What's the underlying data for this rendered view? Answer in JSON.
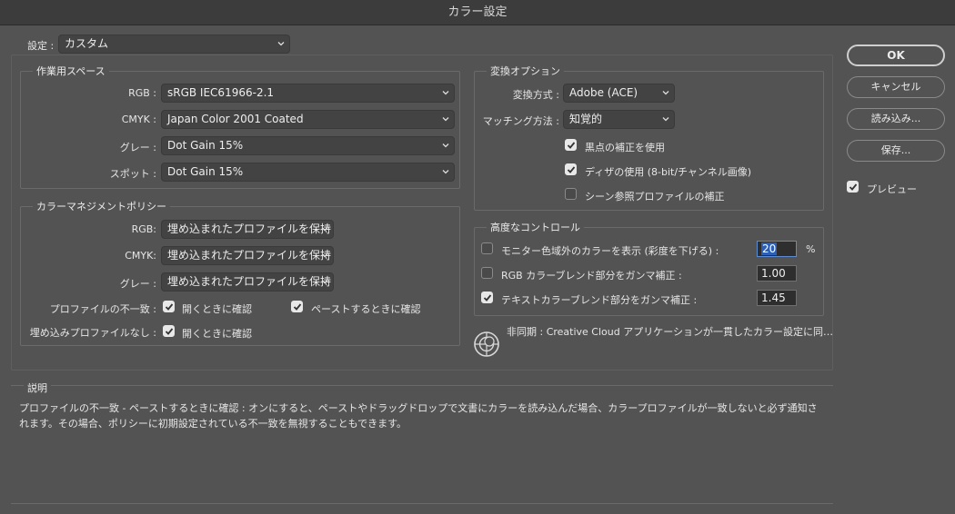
{
  "window": {
    "title": "カラー設定"
  },
  "settings": {
    "label": "設定 :",
    "value": "カスタム"
  },
  "working_spaces": {
    "title": "作業用スペース",
    "rgb": {
      "label": "RGB :",
      "value": "sRGB IEC61966-2.1"
    },
    "cmyk": {
      "label": "CMYK :",
      "value": "Japan Color 2001 Coated"
    },
    "gray": {
      "label": "グレー :",
      "value": "Dot Gain 15%"
    },
    "spot": {
      "label": "スポット :",
      "value": "Dot Gain 15%"
    }
  },
  "policies": {
    "title": "カラーマネジメントポリシー",
    "rgb": {
      "label": "RGB:",
      "value": "埋め込まれたプロファイルを保持"
    },
    "cmyk": {
      "label": "CMYK:",
      "value": "埋め込まれたプロファイルを保持"
    },
    "gray": {
      "label": "グレー :",
      "value": "埋め込まれたプロファイルを保持"
    },
    "mismatch": {
      "label": "プロファイルの不一致 :",
      "open_label": "開くときに確認",
      "open_checked": true,
      "paste_label": "ペーストするときに確認",
      "paste_checked": true
    },
    "missing": {
      "label": "埋め込みプロファイルなし :",
      "open_label": "開くときに確認",
      "open_checked": true
    }
  },
  "conversion": {
    "title": "変換オプション",
    "engine": {
      "label": "変換方式 :",
      "value": "Adobe (ACE)"
    },
    "intent": {
      "label": "マッチング方法 :",
      "value": "知覚的"
    },
    "bpc": {
      "label": "黒点の補正を使用",
      "checked": true
    },
    "dither": {
      "label": "ディザの使用 (8-bit/チャンネル画像)",
      "checked": true
    },
    "scene": {
      "label": "シーン参照プロファイルの補正",
      "checked": false
    }
  },
  "advanced": {
    "title": "高度なコントロール",
    "desaturate": {
      "label": "モニター色域外のカラーを表示 (彩度を下げる) :",
      "checked": false,
      "value": "20",
      "unit": "%"
    },
    "blend_rgb": {
      "label": "RGB カラーブレンド部分をガンマ補正 :",
      "checked": false,
      "value": "1.00"
    },
    "blend_text": {
      "label": "テキストカラーブレンド部分をガンマ補正 :",
      "checked": true,
      "value": "1.45"
    }
  },
  "sync": {
    "text": "非同期 : Creative Cloud アプリケーションが一貫したカラー設定に同…"
  },
  "buttons": {
    "ok": "OK",
    "cancel": "キャンセル",
    "load": "読み込み...",
    "save": "保存..."
  },
  "preview": {
    "label": "プレビュー",
    "checked": true
  },
  "description": {
    "title": "説明",
    "text": "プロファイルの不一致 - ペーストするときに確認 : オンにすると、ペーストやドラッグドロップで文書にカラーを読み込んだ場合、カラープロファイルが一致しないと必ず通知されます。その場合、ポリシーに初期設定されている不一致を無視することもできます。"
  },
  "colors": {
    "panel_bg": "#535353",
    "titlebar_bg": "#3c3c3c",
    "focus_blue": "#2e5fb6"
  }
}
